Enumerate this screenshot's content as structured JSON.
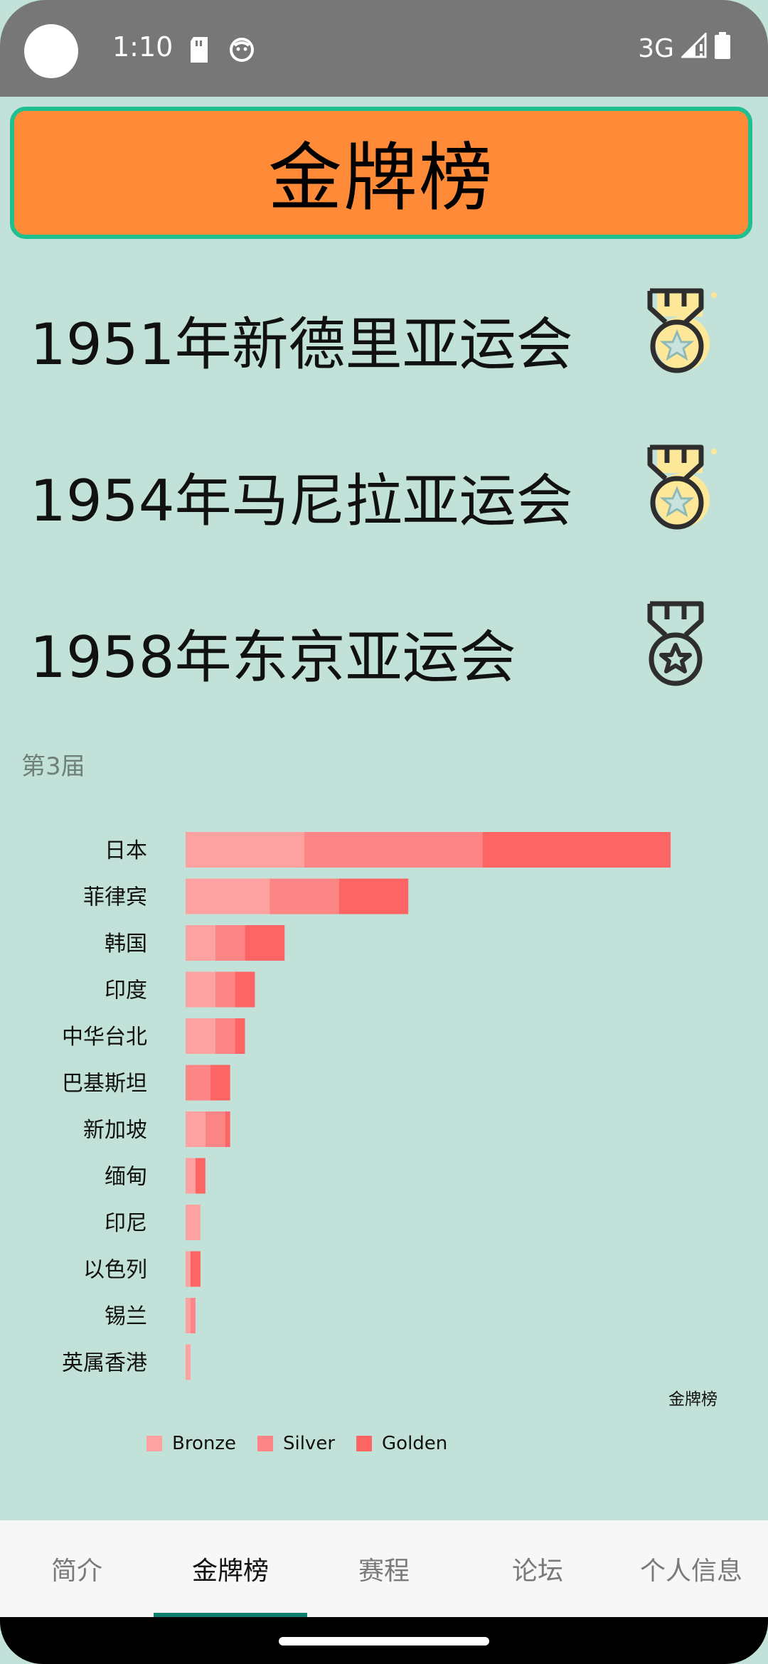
{
  "status_bar": {
    "time": "1:10",
    "network": "3G",
    "icons": [
      "sd-card-icon",
      "face-icon",
      "signal-icon",
      "battery-icon"
    ]
  },
  "header": {
    "title": "金牌榜"
  },
  "list": {
    "items": [
      {
        "label": "1951年新德里亚运会",
        "icon": "medal-filled-icon"
      },
      {
        "label": "1954年马尼拉亚运会",
        "icon": "medal-filled-icon"
      },
      {
        "label": "1958年东京亚运会",
        "icon": "medal-outline-icon"
      }
    ]
  },
  "chart_section": {
    "title": "第3届",
    "note": "金牌榜"
  },
  "chart_data": {
    "type": "bar",
    "orientation": "horizontal",
    "stacked": true,
    "categories": [
      "日本",
      "菲律宾",
      "韩国",
      "印度",
      "中华台北",
      "巴基斯坦",
      "新加坡",
      "缅甸",
      "印尼",
      "以色列",
      "锡兰",
      "英属香港"
    ],
    "series": [
      {
        "name": "Bronze",
        "color": "#fda1a1",
        "values": [
          24,
          17,
          6,
          6,
          6,
          0,
          4,
          2,
          3,
          1,
          1,
          1
        ]
      },
      {
        "name": "Silver",
        "color": "#fd8585",
        "values": [
          36,
          14,
          6,
          4,
          4,
          5,
          4,
          0,
          0,
          0,
          1,
          0
        ]
      },
      {
        "name": "Golden",
        "color": "#fd6565",
        "values": [
          38,
          14,
          8,
          4,
          2,
          4,
          1,
          2,
          0,
          2,
          0,
          0
        ]
      }
    ],
    "xlim": [
      0,
      100
    ],
    "legend": "bottom-left",
    "grid": false
  },
  "bottom_nav": {
    "tabs": [
      {
        "label": "简介",
        "active": false
      },
      {
        "label": "金牌榜",
        "active": true
      },
      {
        "label": "赛程",
        "active": false
      },
      {
        "label": "论坛",
        "active": false
      },
      {
        "label": "个人信息",
        "active": false
      }
    ]
  },
  "colors": {
    "background": "#c2e2d9",
    "header_bg": "#ff8a38",
    "header_border": "#1fbf8f",
    "nav_indicator": "#0d7f6c",
    "medal_fill": "#fde89a",
    "medal_stroke": "#2e2e2e"
  }
}
